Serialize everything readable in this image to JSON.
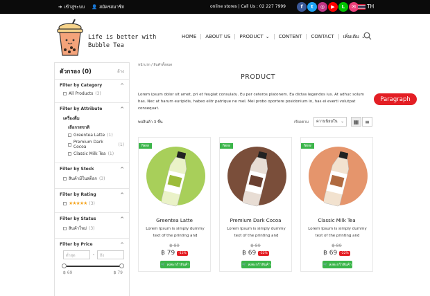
{
  "topbar": {
    "login": "เข้าสู่ระบบ",
    "register": "สมัครสมาชิก",
    "info": "online stores | Call Us : 02 227 7999",
    "lang": "TH",
    "social": [
      {
        "icon": "facebook-icon",
        "glyph": "f",
        "color": "#3b5998"
      },
      {
        "icon": "twitter-icon",
        "glyph": "t",
        "color": "#1da1f2"
      },
      {
        "icon": "instagram-icon",
        "glyph": "◎",
        "color": "#c13584"
      },
      {
        "icon": "youtube-icon",
        "glyph": "▶",
        "color": "#ff0000"
      },
      {
        "icon": "line-icon",
        "glyph": "L",
        "color": "#00c300"
      },
      {
        "icon": "email-icon",
        "glyph": "✉",
        "color": "#ec407a"
      }
    ]
  },
  "brand": {
    "slogan_1": "Life is better with",
    "slogan_2": "Bubble Tea"
  },
  "nav": {
    "home": "HOME",
    "about": "ABOUT US",
    "product": "PRODUCT",
    "content": "CONTENT",
    "contact": "CONTACT",
    "more": "เพิ่มเติม"
  },
  "sidebar": {
    "title": "ตัวกรอง (0)",
    "clear": "ล้าง",
    "category": {
      "title": "Filter by Category",
      "items": [
        {
          "label": "All Products",
          "count": "(3)"
        }
      ]
    },
    "attribute": {
      "title": "Filter by Attribute",
      "group": "เครื่องดื่ม",
      "sub": "เลือกรสชาติ",
      "items": [
        {
          "label": "Greentea Latte",
          "count": "(1)"
        },
        {
          "label": "Premium Dark Cocoa",
          "count": "(1)"
        },
        {
          "label": "Classic Milk Tea",
          "count": "(1)"
        }
      ]
    },
    "stock": {
      "title": "Filter by Stock",
      "items": [
        {
          "label": "สินค้ามีในสต็อก",
          "count": "(3)"
        }
      ]
    },
    "rating": {
      "title": "Filter by Rating",
      "stars": "★★★★★",
      "count": "(3)"
    },
    "status": {
      "title": "Filter by Status",
      "items": [
        {
          "label": "สินค้าใหม่",
          "count": "(3)"
        }
      ]
    },
    "price": {
      "title": "Filter by Price",
      "min_placeholder": "ต่ำสุด",
      "max_placeholder": "ถึง",
      "min_label": "฿ 69",
      "max_label": "฿ 79"
    }
  },
  "main": {
    "breadcrumb": "หน้าแรก  /  สินค้าทั้งหมด",
    "title": "PRODUCT",
    "paragraph": "Lorem ipsum dolor sit amet, pri et feugiat consulatu. Eu per ceteros platonem. Ea dictas legendos ius. At adhuc solum has. Nec at harum euripidis, habeo elitr patrique ne mel. Mei probo oportere posidonium in, has ei everti volutpat consequat.",
    "badge": "Paragraph",
    "count_text": "พบสินค้า 3 ชิ้น",
    "sort_label": "เรียงตาม",
    "sort_value": "ความนิยมใน",
    "new_label": "New",
    "add_label": "ลงตะกร้าสินค้า",
    "products": [
      {
        "name": "Greentea Latte",
        "desc": "Lorem Ipsum is simply dummy text of the printing and",
        "old_price": "฿ 89",
        "price": "฿ 79",
        "discount": "-11%",
        "bg": "#a8cf5a"
      },
      {
        "name": "Premium Dark Cocoa",
        "desc": "Lorem Ipsum is simply dummy text of the printing and",
        "old_price": "฿ 89",
        "price": "฿ 69",
        "discount": "-22%",
        "bg": "#7a4e3a"
      },
      {
        "name": "Classic Milk Tea",
        "desc": "Lorem Ipsum is simply dummy text of the printing and",
        "old_price": "฿ 89",
        "price": "฿ 69",
        "discount": "-22%",
        "bg": "#e5956c"
      }
    ]
  },
  "colors": {
    "accent_red": "#e31e24",
    "accent_green": "#3bb54a"
  }
}
